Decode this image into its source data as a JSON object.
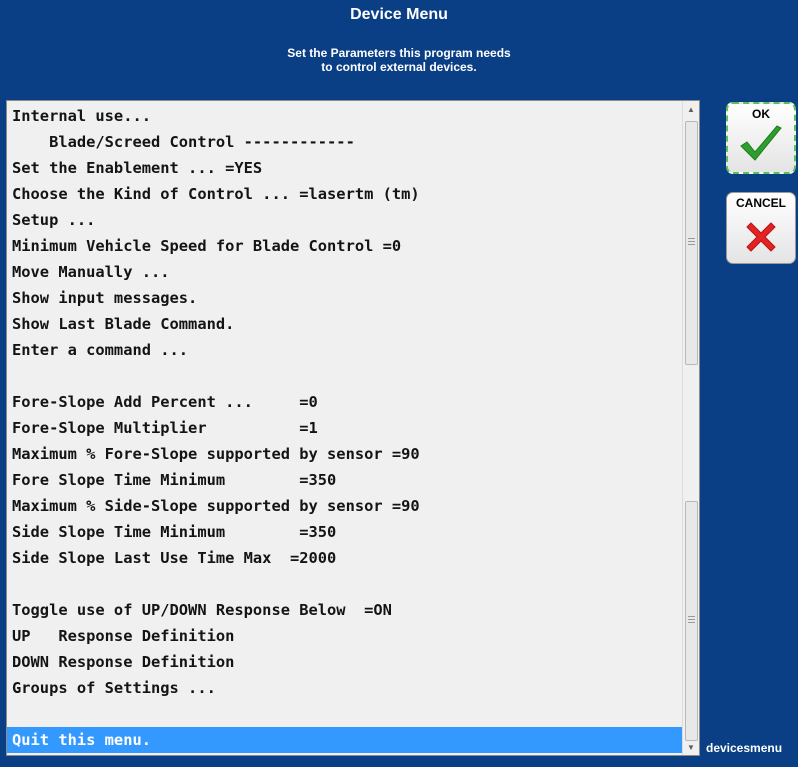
{
  "header": {
    "title": "Device Menu",
    "subtitle_line1": "Set the Parameters this program needs",
    "subtitle_line2": "to control external devices."
  },
  "menu": {
    "items": [
      "Internal use...",
      "    Blade/Screed Control ------------",
      "Set the Enablement ... =YES",
      "Choose the Kind of Control ... =lasertm (tm)",
      "Setup ...",
      "Minimum Vehicle Speed for Blade Control =0",
      "Move Manually ...",
      "Show input messages.",
      "Show Last Blade Command.",
      "Enter a command ...",
      "",
      "Fore-Slope Add Percent ...     =0",
      "Fore-Slope Multiplier          =1",
      "Maximum % Fore-Slope supported by sensor =90",
      "Fore Slope Time Minimum        =350",
      "Maximum % Side-Slope supported by sensor =90",
      "Side Slope Time Minimum        =350",
      "Side Slope Last Use Time Max  =2000",
      "",
      "Toggle use of UP/DOWN Response Below  =ON",
      "UP   Response Definition",
      "DOWN Response Definition",
      "Groups of Settings ...",
      "",
      "Quit this menu."
    ],
    "selected_index": 24
  },
  "buttons": {
    "ok_label": "OK",
    "cancel_label": "CANCEL"
  },
  "icons": {
    "ok": "checkmark-icon",
    "cancel": "x-icon"
  },
  "colors": {
    "background": "#0a3f86",
    "selection": "#3399ff",
    "check": "#2e9e2e",
    "cross": "#e32222"
  },
  "footer": {
    "label": "devicesmenu"
  }
}
